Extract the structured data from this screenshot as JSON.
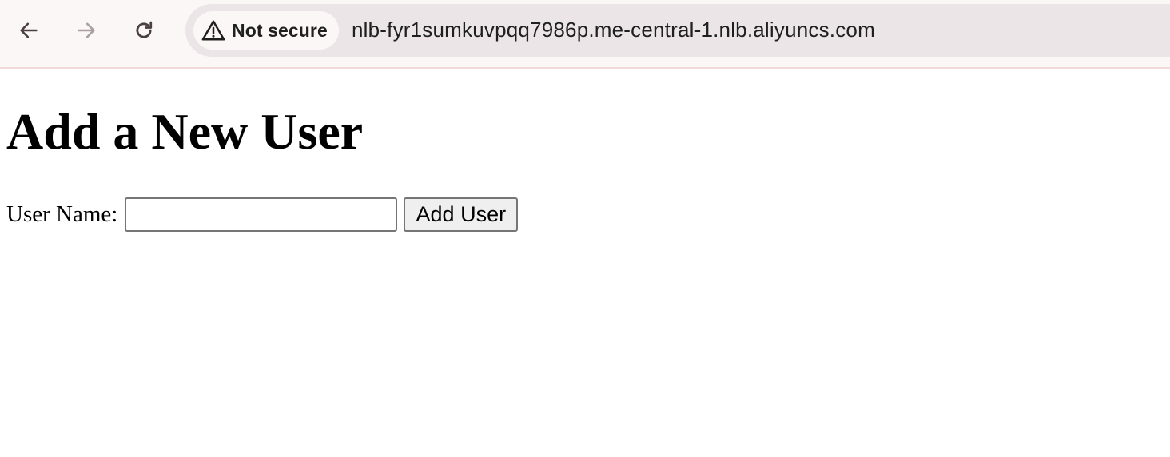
{
  "browser": {
    "security_label": "Not secure",
    "url": "nlb-fyr1sumkuvpqq7986p.me-central-1.nlb.aliyuncs.com",
    "icons": [
      "back-arrow-icon",
      "forward-arrow-icon",
      "reload-icon",
      "warning-triangle-icon"
    ]
  },
  "page": {
    "title": "Add a New User",
    "form": {
      "field_label": "User Name:",
      "input_value": "",
      "submit_label": "Add User"
    }
  }
}
